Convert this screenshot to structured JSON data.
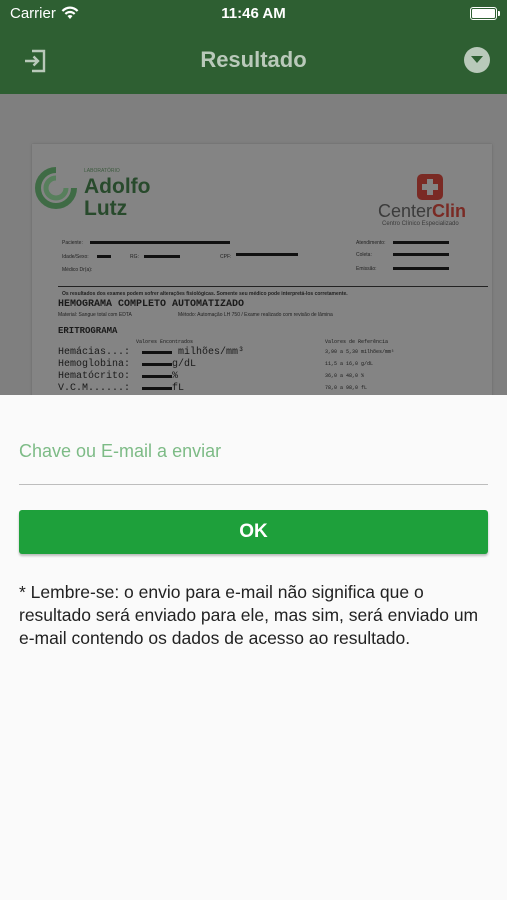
{
  "status_bar": {
    "carrier": "Carrier",
    "time": "11:46 AM"
  },
  "nav": {
    "title": "Resultado",
    "left_icon": "exit-icon",
    "right_icon": "chevron-down-icon"
  },
  "document": {
    "lab_small": "LABORATÓRIO",
    "lab_name_1": "Adolfo",
    "lab_name_2": "Lutz",
    "clinic_name_a": "Center",
    "clinic_name_b": "Clin",
    "clinic_sub": "Centro Clínico Especializado",
    "fields": {
      "paciente": "Paciente:",
      "idade_sexo": "Idade/Sexo:",
      "rg": "RG:",
      "cpf": "CPF:",
      "medico": "Médico Dr(a):",
      "atendimento": "Atendimento:",
      "coleta": "Coleta:",
      "emissao": "Emissão:"
    },
    "warning": "Os resultados dos exames podem sofrer alterações fisiológicas. Somente seu médico pode interpretá-los corretamente.",
    "exam_title": "HEMOGRAMA COMPLETO AUTOMATIZADO",
    "material": "Material: Sangue total com EDTA",
    "metodo": "Método: Automação LH 750 / Exame realizado com revisão de lâmina",
    "section": "ERITROGRAMA",
    "col_found": "Valores Encontrados",
    "col_ref": "Valores de Referência",
    "rows": [
      {
        "label": "Hemácias...:",
        "unit": "milhões/mm³",
        "ref": "3,90 a 5,30 milhões/mm³"
      },
      {
        "label": "Hemoglobina:",
        "unit": "g/dL",
        "ref": "11,5 a 16,0 g/dL"
      },
      {
        "label": "Hematócrito:",
        "unit": "%",
        "ref": "36,0 a 48,0 %"
      },
      {
        "label": "V.C.M......:",
        "unit": "fL",
        "ref": "78,0 a 98,0 fL"
      }
    ]
  },
  "sheet": {
    "input_placeholder": "Chave ou E-mail a enviar",
    "ok_label": "OK",
    "note": "* Lembre-se: o envio para e-mail não significa que o resultado será enviado para ele, mas sim, será enviado um e-mail contendo os dados de acesso ao resultado."
  },
  "colors": {
    "nav_bg": "#2e5f32",
    "nav_title": "#b9c9ba",
    "ok_button": "#1ea03b",
    "placeholder": "#7dbb86"
  }
}
